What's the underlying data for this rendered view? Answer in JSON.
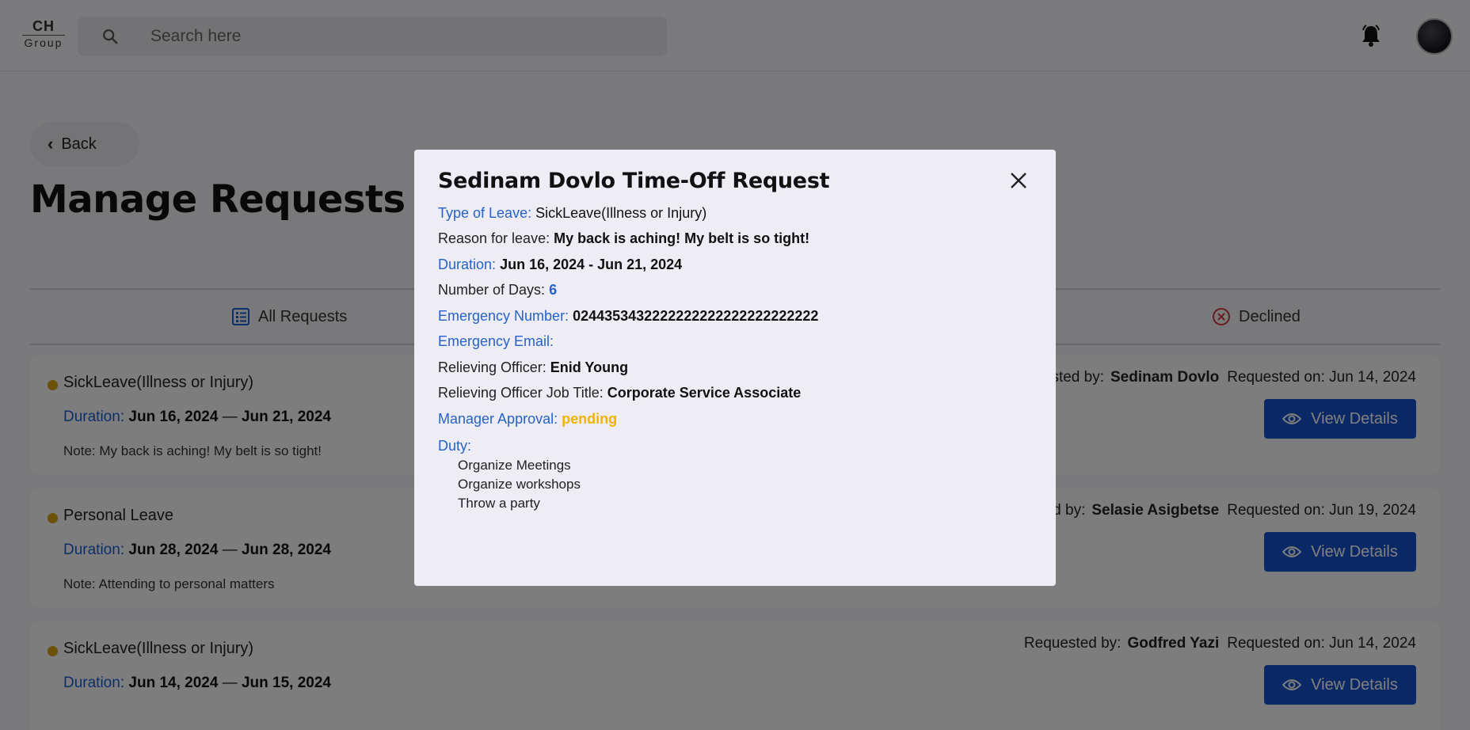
{
  "header": {
    "logo_top": "CH",
    "logo_bottom": "Group",
    "search_placeholder": "Search here"
  },
  "page": {
    "back_label": "Back",
    "title": "Manage Requests"
  },
  "tabs": [
    {
      "label": "All Requests"
    },
    {
      "label": "Declined"
    }
  ],
  "cards": [
    {
      "type": "SickLeave(Illness or Injury)",
      "duration_label": "Duration:",
      "start": "Jun 16, 2024",
      "end": "Jun 21, 2024",
      "note_label": "Note:",
      "note": "My back is aching! My belt is so tight!",
      "requested_by_label": "ested by:",
      "requested_by": "Sedinam Dovlo",
      "requested_on_label": "Requested on:",
      "requested_on": "Jun 14, 2024",
      "button": "View Details"
    },
    {
      "type": "Personal Leave",
      "duration_label": "Duration:",
      "start": "Jun 28, 2024",
      "end": "Jun 28, 2024",
      "note_label": "Note:",
      "note": "Attending to personal matters",
      "requested_by_label": "ed by:",
      "requested_by": "Selasie Asigbetse",
      "requested_on_label": "Requested on:",
      "requested_on": "Jun 19, 2024",
      "button": "View Details"
    },
    {
      "type": "SickLeave(Illness or Injury)",
      "duration_label": "Duration:",
      "start": "Jun 14, 2024",
      "end": "Jun 15, 2024",
      "note_label": "",
      "note": "",
      "requested_by_label": "Requested by:",
      "requested_by": "Godfred Yazi",
      "requested_on_label": "Requested on:",
      "requested_on": "Jun 14, 2024",
      "button": "View Details"
    }
  ],
  "modal": {
    "title": "Sedinam Dovlo Time-Off Request",
    "type_label": "Type of Leave:",
    "type_value": "SickLeave(Illness or Injury)",
    "reason_label": "Reason for leave:",
    "reason_value": "My back is aching! My belt is so tight!",
    "duration_label": "Duration:",
    "duration_value": "Jun 16, 2024 - Jun 21, 2024",
    "days_label": "Number of Days:",
    "days_value": "6",
    "emergency_number_label": "Emergency Number:",
    "emergency_number_value": "0244353432222222222222222222222",
    "emergency_email_label": "Emergency Email:",
    "relieving_officer_label": "Relieving Officer:",
    "relieving_officer_value": "Enid Young",
    "relieving_title_label": "Relieving Officer Job Title:",
    "relieving_title_value": "Corporate Service Associate",
    "manager_approval_label": "Manager Approval:",
    "manager_approval_value": "pending",
    "duty_label": "Duty:",
    "duties": [
      "Organize Meetings",
      "Organize workshops",
      "Throw a party"
    ]
  },
  "colors": {
    "accent_blue": "#2563c9",
    "button_blue": "#1650cc",
    "pending_yellow": "#f0b400",
    "status_dot": "#d6a511",
    "declined_red": "#d23a3a"
  }
}
